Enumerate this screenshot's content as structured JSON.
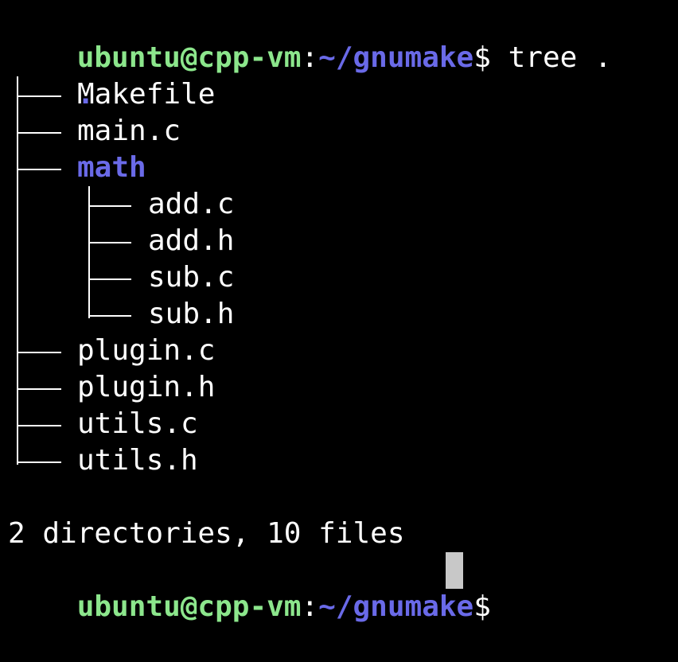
{
  "prompt": {
    "user_host": "ubuntu@cpp-vm",
    "colon": ":",
    "path": "~/gnumake",
    "dollar": "$"
  },
  "command": "tree .",
  "tree": {
    "root": ".",
    "entries": [
      {
        "name": "Makefile",
        "type": "file"
      },
      {
        "name": "main.c",
        "type": "file"
      },
      {
        "name": "math",
        "type": "dir",
        "children": [
          {
            "name": "add.c",
            "type": "file"
          },
          {
            "name": "add.h",
            "type": "file"
          },
          {
            "name": "sub.c",
            "type": "file"
          },
          {
            "name": "sub.h",
            "type": "file"
          }
        ]
      },
      {
        "name": "plugin.c",
        "type": "file"
      },
      {
        "name": "plugin.h",
        "type": "file"
      },
      {
        "name": "utils.c",
        "type": "file"
      },
      {
        "name": "utils.h",
        "type": "file"
      }
    ]
  },
  "summary": "2 directories, 10 files",
  "colors": {
    "background": "#000000",
    "user_host": "#8ce68c",
    "path": "#6a6ae8",
    "directory": "#6a6ae8",
    "text": "#ffffff",
    "cursor": "#c8c8c8"
  }
}
